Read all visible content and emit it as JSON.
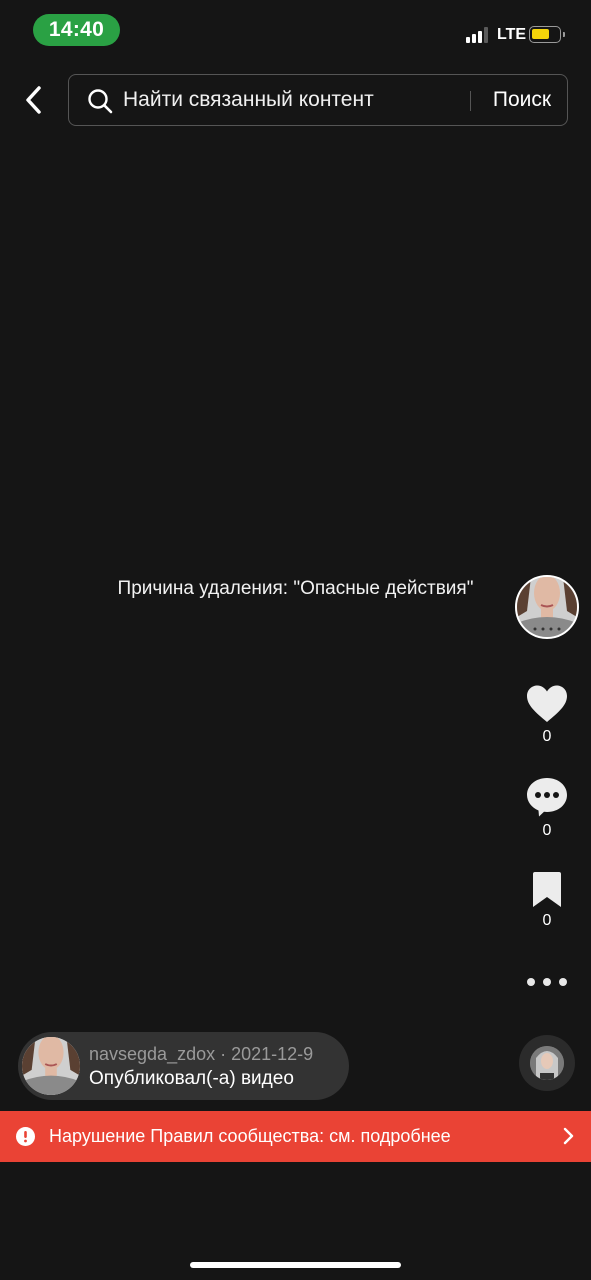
{
  "status_bar": {
    "time": "14:40",
    "network": "LTE",
    "colors": {
      "time_pill": "#2aa144",
      "battery_fill": "#f5d50a"
    }
  },
  "header": {
    "back_icon": "chevron-left-icon",
    "search": {
      "icon": "search-icon",
      "placeholder": "Найти связанный контент",
      "submit_label": "Поиск"
    }
  },
  "video": {
    "removal_reason": "Причина удаления: \"Опасные действия\""
  },
  "actions": {
    "like": {
      "icon": "heart-icon",
      "count": "0"
    },
    "comment": {
      "icon": "comment-icon",
      "count": "0"
    },
    "save": {
      "icon": "bookmark-icon",
      "count": "0"
    },
    "more_icon": "more-dots-icon"
  },
  "author": {
    "username": "navsegda_zdox",
    "date": "2021-12-9",
    "meta_line": "navsegda_zdox · 2021-12-9",
    "action": "Опубликовал(-а) видео"
  },
  "violation_banner": {
    "icon": "alert-circle-icon",
    "text": "Нарушение Правил сообщества: см. подробнее",
    "chevron_icon": "chevron-right-icon",
    "color": "#ea4335"
  }
}
